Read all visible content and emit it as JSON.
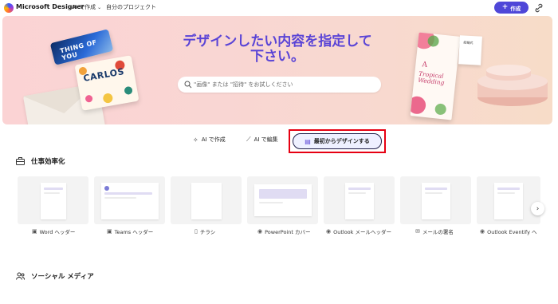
{
  "app": {
    "brand": "Microsoft Designer"
  },
  "nav": {
    "create_ai": "AI で作成",
    "my_projects": "自分のプロジェクト",
    "create_button": "作成"
  },
  "hero": {
    "title_line1": "デザインしたい内容を指定して",
    "title_line2": "下さい。",
    "search_placeholder": "\"画像\" または \"招待\" をお試しください",
    "card_a_text": "THING OF YOU",
    "card_b_name": "CARLOS",
    "wedding_a": "A",
    "wedding_title": "Tropical Wedding",
    "small_card_text": "結婚式"
  },
  "tabs": [
    {
      "label": "AI で作成",
      "icon": "sparkle-icon"
    },
    {
      "label": "AI で編集",
      "icon": "wand-icon"
    },
    {
      "label": "最初からデザインする",
      "icon": "design-icon",
      "active": true
    }
  ],
  "sections": {
    "productivity": {
      "title": "仕事効率化",
      "items": [
        {
          "label": "Word ヘッダー",
          "icon": "word-icon"
        },
        {
          "label": "Teams ヘッダー",
          "icon": "teams-icon"
        },
        {
          "label": "チラシ",
          "icon": "flyer-icon"
        },
        {
          "label": "PowerPoint カバー",
          "icon": "powerpoint-icon"
        },
        {
          "label": "Outlook メールヘッダー",
          "icon": "outlook-icon"
        },
        {
          "label": "メールの署名",
          "icon": "mail-icon"
        },
        {
          "label": "Outlook Eventify ヘ",
          "icon": "outlook-icon"
        }
      ]
    },
    "social": {
      "title": "ソーシャル メディア"
    }
  },
  "colors": {
    "accent": "#4f47d8",
    "hero_title": "#5a44d6",
    "highlight_border": "#e60012"
  }
}
